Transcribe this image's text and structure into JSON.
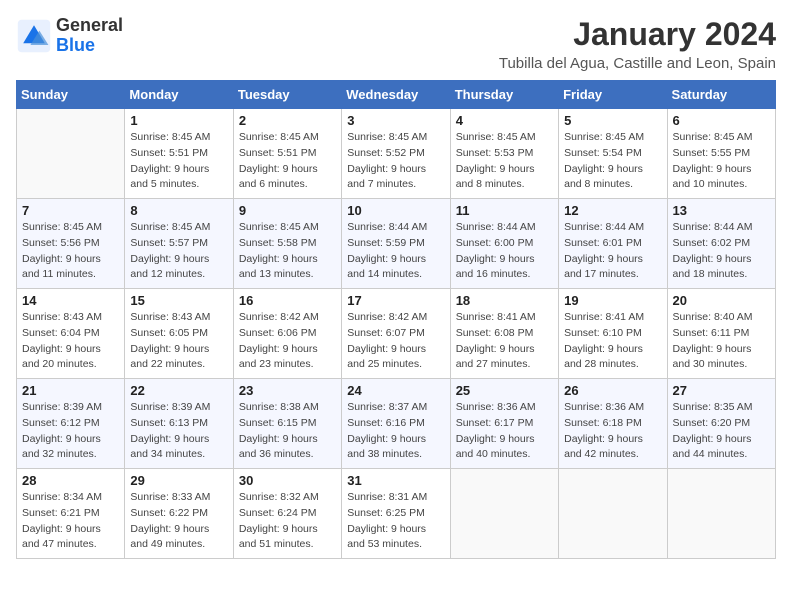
{
  "header": {
    "logo_general": "General",
    "logo_blue": "Blue",
    "title": "January 2024",
    "subtitle": "Tubilla del Agua, Castille and Leon, Spain"
  },
  "days_of_week": [
    "Sunday",
    "Monday",
    "Tuesday",
    "Wednesday",
    "Thursday",
    "Friday",
    "Saturday"
  ],
  "weeks": [
    [
      {
        "day": "",
        "info": ""
      },
      {
        "day": "1",
        "info": "Sunrise: 8:45 AM\nSunset: 5:51 PM\nDaylight: 9 hours\nand 5 minutes."
      },
      {
        "day": "2",
        "info": "Sunrise: 8:45 AM\nSunset: 5:51 PM\nDaylight: 9 hours\nand 6 minutes."
      },
      {
        "day": "3",
        "info": "Sunrise: 8:45 AM\nSunset: 5:52 PM\nDaylight: 9 hours\nand 7 minutes."
      },
      {
        "day": "4",
        "info": "Sunrise: 8:45 AM\nSunset: 5:53 PM\nDaylight: 9 hours\nand 8 minutes."
      },
      {
        "day": "5",
        "info": "Sunrise: 8:45 AM\nSunset: 5:54 PM\nDaylight: 9 hours\nand 8 minutes."
      },
      {
        "day": "6",
        "info": "Sunrise: 8:45 AM\nSunset: 5:55 PM\nDaylight: 9 hours\nand 10 minutes."
      }
    ],
    [
      {
        "day": "7",
        "info": "Sunrise: 8:45 AM\nSunset: 5:56 PM\nDaylight: 9 hours\nand 11 minutes."
      },
      {
        "day": "8",
        "info": "Sunrise: 8:45 AM\nSunset: 5:57 PM\nDaylight: 9 hours\nand 12 minutes."
      },
      {
        "day": "9",
        "info": "Sunrise: 8:45 AM\nSunset: 5:58 PM\nDaylight: 9 hours\nand 13 minutes."
      },
      {
        "day": "10",
        "info": "Sunrise: 8:44 AM\nSunset: 5:59 PM\nDaylight: 9 hours\nand 14 minutes."
      },
      {
        "day": "11",
        "info": "Sunrise: 8:44 AM\nSunset: 6:00 PM\nDaylight: 9 hours\nand 16 minutes."
      },
      {
        "day": "12",
        "info": "Sunrise: 8:44 AM\nSunset: 6:01 PM\nDaylight: 9 hours\nand 17 minutes."
      },
      {
        "day": "13",
        "info": "Sunrise: 8:44 AM\nSunset: 6:02 PM\nDaylight: 9 hours\nand 18 minutes."
      }
    ],
    [
      {
        "day": "14",
        "info": "Sunrise: 8:43 AM\nSunset: 6:04 PM\nDaylight: 9 hours\nand 20 minutes."
      },
      {
        "day": "15",
        "info": "Sunrise: 8:43 AM\nSunset: 6:05 PM\nDaylight: 9 hours\nand 22 minutes."
      },
      {
        "day": "16",
        "info": "Sunrise: 8:42 AM\nSunset: 6:06 PM\nDaylight: 9 hours\nand 23 minutes."
      },
      {
        "day": "17",
        "info": "Sunrise: 8:42 AM\nSunset: 6:07 PM\nDaylight: 9 hours\nand 25 minutes."
      },
      {
        "day": "18",
        "info": "Sunrise: 8:41 AM\nSunset: 6:08 PM\nDaylight: 9 hours\nand 27 minutes."
      },
      {
        "day": "19",
        "info": "Sunrise: 8:41 AM\nSunset: 6:10 PM\nDaylight: 9 hours\nand 28 minutes."
      },
      {
        "day": "20",
        "info": "Sunrise: 8:40 AM\nSunset: 6:11 PM\nDaylight: 9 hours\nand 30 minutes."
      }
    ],
    [
      {
        "day": "21",
        "info": "Sunrise: 8:39 AM\nSunset: 6:12 PM\nDaylight: 9 hours\nand 32 minutes."
      },
      {
        "day": "22",
        "info": "Sunrise: 8:39 AM\nSunset: 6:13 PM\nDaylight: 9 hours\nand 34 minutes."
      },
      {
        "day": "23",
        "info": "Sunrise: 8:38 AM\nSunset: 6:15 PM\nDaylight: 9 hours\nand 36 minutes."
      },
      {
        "day": "24",
        "info": "Sunrise: 8:37 AM\nSunset: 6:16 PM\nDaylight: 9 hours\nand 38 minutes."
      },
      {
        "day": "25",
        "info": "Sunrise: 8:36 AM\nSunset: 6:17 PM\nDaylight: 9 hours\nand 40 minutes."
      },
      {
        "day": "26",
        "info": "Sunrise: 8:36 AM\nSunset: 6:18 PM\nDaylight: 9 hours\nand 42 minutes."
      },
      {
        "day": "27",
        "info": "Sunrise: 8:35 AM\nSunset: 6:20 PM\nDaylight: 9 hours\nand 44 minutes."
      }
    ],
    [
      {
        "day": "28",
        "info": "Sunrise: 8:34 AM\nSunset: 6:21 PM\nDaylight: 9 hours\nand 47 minutes."
      },
      {
        "day": "29",
        "info": "Sunrise: 8:33 AM\nSunset: 6:22 PM\nDaylight: 9 hours\nand 49 minutes."
      },
      {
        "day": "30",
        "info": "Sunrise: 8:32 AM\nSunset: 6:24 PM\nDaylight: 9 hours\nand 51 minutes."
      },
      {
        "day": "31",
        "info": "Sunrise: 8:31 AM\nSunset: 6:25 PM\nDaylight: 9 hours\nand 53 minutes."
      },
      {
        "day": "",
        "info": ""
      },
      {
        "day": "",
        "info": ""
      },
      {
        "day": "",
        "info": ""
      }
    ]
  ]
}
